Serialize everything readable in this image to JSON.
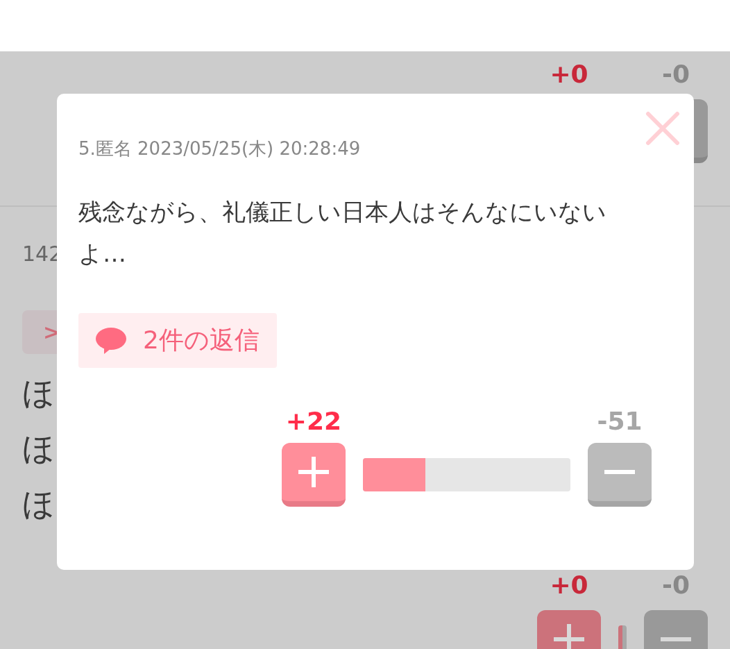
{
  "background_comments": [
    {
      "votes": {
        "plus_count": "+0",
        "minus_count": "-0"
      }
    },
    {
      "number": "142",
      "quote_marker": ">",
      "text_lines": [
        "ほ",
        "ほ",
        "ほ"
      ],
      "votes": {
        "plus_count": "+0",
        "minus_count": "-0"
      }
    }
  ],
  "modal": {
    "header": "5.匿名 2023/05/25(木) 20:28:49",
    "body": "残念ながら、礼儀正しい日本人はそんなにいないよ…",
    "reply_button": "2件の返信",
    "votes": {
      "plus_count": "+22",
      "minus_count": "-51",
      "level": 0.3
    }
  }
}
